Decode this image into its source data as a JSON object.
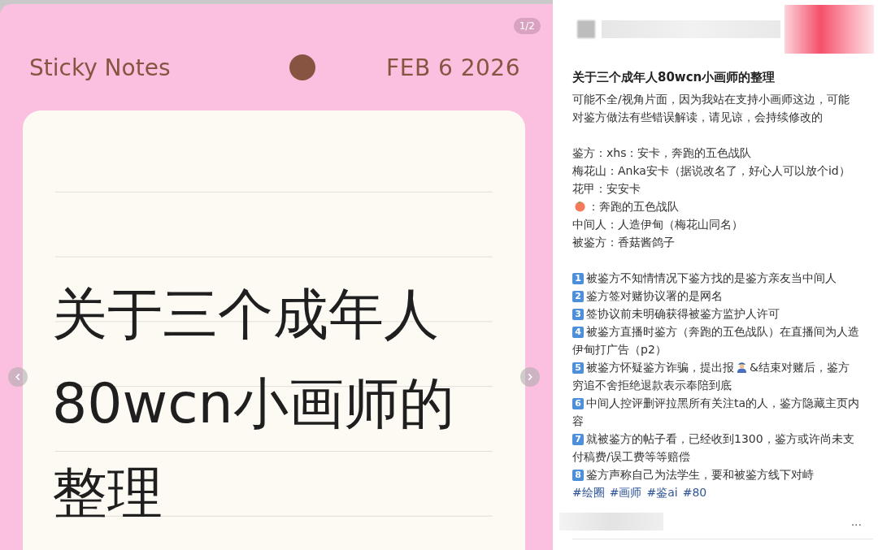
{
  "image_viewer": {
    "page_indicator": "1/2",
    "note": {
      "app_title": "Sticky Notes",
      "date": "FEB 6 2026",
      "lines": [
        "关于三个成年人",
        "80wcn小画师的",
        "整理"
      ]
    }
  },
  "post": {
    "title": "关于三个成年人80wcn小画师的整理",
    "intro": "可能不全/视角片面，因为我站在支持小画师这边，可能对鉴方做法有些错误解读，请见谅，会持续修改的",
    "roles": [
      {
        "kind": "text",
        "text": "鉴方：xhs：安卡，奔跑的五色战队"
      },
      {
        "kind": "text",
        "text": "梅花山：Anka安卡（据说改名了，好心人可以放个id）"
      },
      {
        "kind": "text",
        "text": "花甲：安安卡"
      },
      {
        "kind": "peach",
        "text": "：奔跑的五色战队"
      },
      {
        "kind": "text",
        "text": "中间人：人造伊甸（梅花山同名）"
      },
      {
        "kind": "text",
        "text": "被鉴方：香菇酱鸽子"
      }
    ],
    "points": [
      {
        "number": "1",
        "segments": [
          "被鉴方不知情情况下鉴方找的是鉴方亲友当中间人"
        ]
      },
      {
        "number": "2",
        "segments": [
          "鉴方签对赌协议署的是网名"
        ]
      },
      {
        "number": "3",
        "segments": [
          "签协议前未明确获得被鉴方监护人许可"
        ]
      },
      {
        "number": "4",
        "segments": [
          "被鉴方直播时鉴方（奔跑的五色战队）在直播间为人造伊甸打广告（p2）"
        ]
      },
      {
        "number": "5",
        "segments": [
          "被鉴方怀疑鉴方诈骗，提出报",
          "&结束对赌后，鉴方穷追不舍拒绝退款表示奉陪到底"
        ]
      },
      {
        "number": "6",
        "segments": [
          "中间人控评删评拉黑所有关注ta的人，鉴方隐藏主页内容"
        ]
      },
      {
        "number": "7",
        "segments": [
          "就被鉴方的帖子看，已经收到1300，鉴方或许尚未支付稿费/误工费等等赔偿"
        ]
      },
      {
        "number": "8",
        "segments": [
          "鉴方声称自己为法学生，要和被鉴方线下对峙"
        ]
      }
    ],
    "tags": [
      "#绘圈",
      "#画师",
      "#鉴ai",
      "#80"
    ],
    "more": "..."
  }
}
